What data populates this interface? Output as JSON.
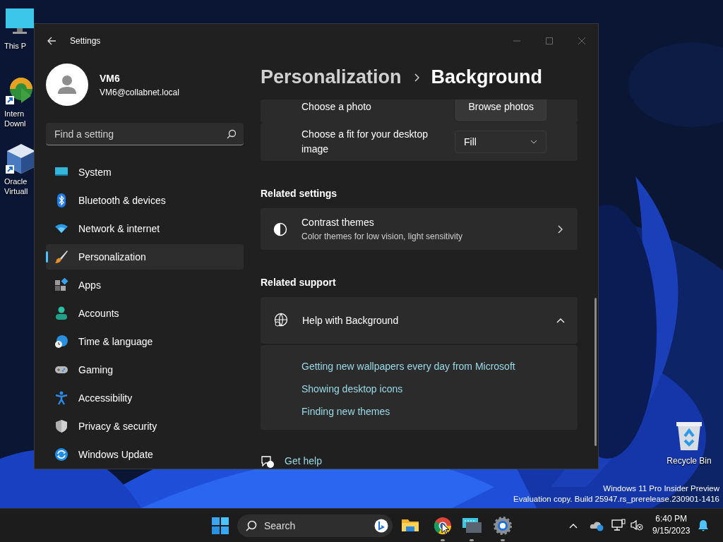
{
  "desktop": {
    "icons": [
      {
        "kind": "monitor",
        "lines": [
          "This P"
        ]
      },
      {
        "kind": "download",
        "lines": [
          "Intern",
          "Downl"
        ]
      },
      {
        "kind": "cube",
        "lines": [
          "Oracle",
          "Virtuall"
        ]
      }
    ],
    "recycle_bin": {
      "label": "Recycle Bin"
    },
    "notice_lines": [
      "Windows 11 Pro Insider Preview",
      "Evaluation copy. Build 25947.rs_prerelease.230901-1416"
    ]
  },
  "settings_window": {
    "title": "Settings",
    "user": {
      "name": "VM6",
      "email": "VM6@collabnet.local"
    },
    "search": {
      "placeholder": "Find a setting"
    },
    "nav": [
      {
        "label": "System",
        "selected": false
      },
      {
        "label": "Bluetooth & devices",
        "selected": false
      },
      {
        "label": "Network & internet",
        "selected": false
      },
      {
        "label": "Personalization",
        "selected": true
      },
      {
        "label": "Apps",
        "selected": false
      },
      {
        "label": "Accounts",
        "selected": false
      },
      {
        "label": "Time & language",
        "selected": false
      },
      {
        "label": "Gaming",
        "selected": false
      },
      {
        "label": "Accessibility",
        "selected": false
      },
      {
        "label": "Privacy & security",
        "selected": false
      },
      {
        "label": "Windows Update",
        "selected": false
      }
    ],
    "breadcrumb": [
      "Personalization",
      "Background"
    ],
    "rows": [
      {
        "kind": "button",
        "label": "Choose a photo",
        "control": "Browse photos"
      },
      {
        "kind": "dropdown",
        "label": "Choose a fit for your desktop image",
        "value": "Fill"
      }
    ],
    "related_settings": {
      "heading": "Related settings",
      "items": [
        {
          "title": "Contrast themes",
          "subtitle": "Color themes for low vision, light sensitivity"
        }
      ]
    },
    "related_support": {
      "heading": "Related support",
      "title": "Help with Background",
      "expanded": true,
      "links": [
        "Getting new wallpapers every day from Microsoft",
        "Showing desktop icons",
        "Finding new themes"
      ]
    },
    "get_help": "Get help"
  },
  "taskbar": {
    "search_placeholder": "Search",
    "apps": [
      {
        "kind": "explorer",
        "running": false
      },
      {
        "kind": "chrome",
        "running": true
      },
      {
        "kind": "remote",
        "running": true
      },
      {
        "kind": "settings",
        "running": true
      }
    ],
    "time": "6:40 PM",
    "date": "9/15/2023"
  }
}
